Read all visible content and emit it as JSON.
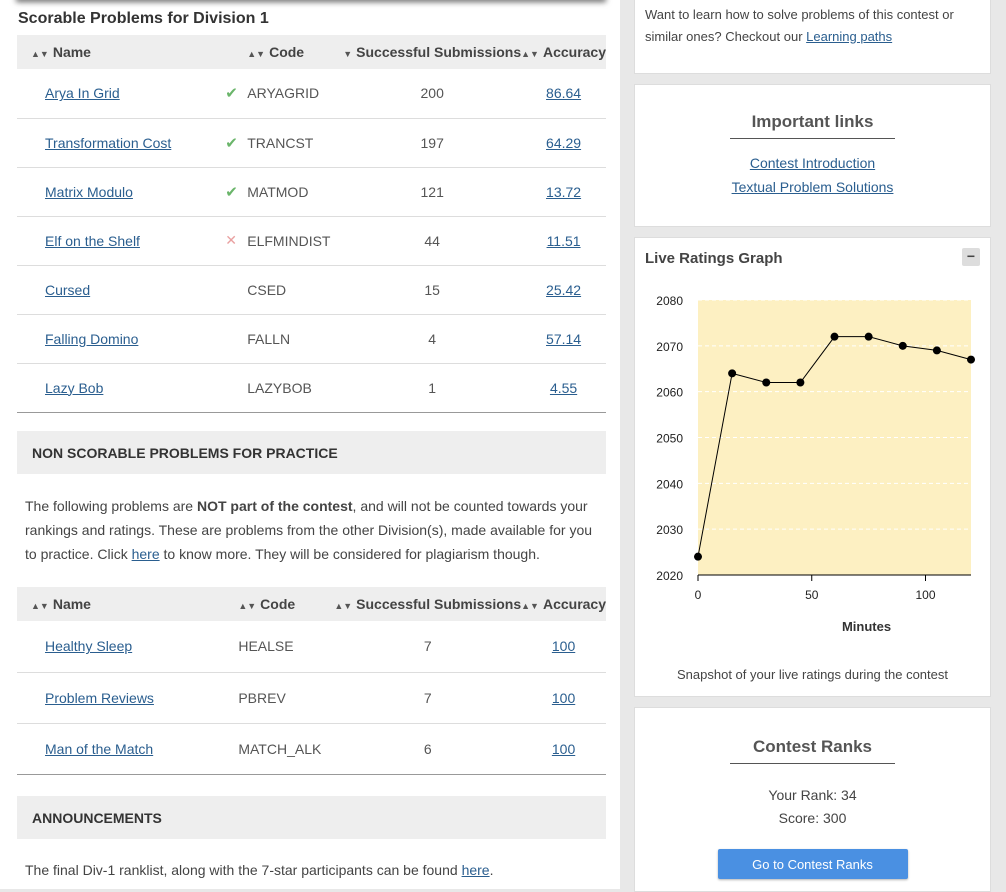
{
  "scorable": {
    "title": "Scorable Problems for Division 1",
    "headers": {
      "name": "Name",
      "code": "Code",
      "subs": "Successful Submissions",
      "acc": "Accuracy"
    },
    "rows": [
      {
        "name": "Arya In Grid",
        "status": "solved",
        "code": "ARYAGRID",
        "subs": "200",
        "acc": "86.64"
      },
      {
        "name": "Transformation Cost",
        "status": "solved",
        "code": "TRANCST",
        "subs": "197",
        "acc": "64.29"
      },
      {
        "name": "Matrix Modulo",
        "status": "solved",
        "code": "MATMOD",
        "subs": "121",
        "acc": "13.72"
      },
      {
        "name": "Elf on the Shelf",
        "status": "wrong",
        "code": "ELFMINDIST",
        "subs": "44",
        "acc": "11.51"
      },
      {
        "name": "Cursed",
        "status": "",
        "code": "CSED",
        "subs": "15",
        "acc": "25.42"
      },
      {
        "name": "Falling Domino",
        "status": "",
        "code": "FALLN",
        "subs": "4",
        "acc": "57.14"
      },
      {
        "name": "Lazy Bob",
        "status": "",
        "code": "LAZYBOB",
        "subs": "1",
        "acc": "4.55"
      }
    ]
  },
  "nonscorable": {
    "heading": "NON SCORABLE PROBLEMS FOR PRACTICE",
    "para_part1": "The following problems are ",
    "para_bold": "NOT part of the contest",
    "para_part2": ", and will not be counted towards your rankings and ratings. These are problems from the other Division(s), made available for you to practice. Click ",
    "para_link": "here",
    "para_part3": " to know more. They will be considered for plagiarism though.",
    "headers": {
      "name": "Name",
      "code": "Code",
      "subs": "Successful Submissions",
      "acc": "Accuracy"
    },
    "rows": [
      {
        "name": "Healthy Sleep",
        "code": "HEALSE",
        "subs": "7",
        "acc": "100"
      },
      {
        "name": "Problem Reviews",
        "code": "PBREV",
        "subs": "7",
        "acc": "100"
      },
      {
        "name": "Man of the Match",
        "code": "MATCH_ALK",
        "subs": "6",
        "acc": "100"
      }
    ]
  },
  "announcements": {
    "heading": "ANNOUNCEMENTS",
    "text_part1": "The final Div-1 ranklist, along with the 7-star participants can be found ",
    "link": "here",
    "text_part2": "."
  },
  "learn": {
    "text": "Want to learn how to solve problems of this contest or similar ones? Checkout our ",
    "link": "Learning paths"
  },
  "important_links": {
    "title": "Important links",
    "links": [
      "Contest Introduction",
      "Textual Problem Solutions"
    ]
  },
  "ratings_graph": {
    "title": "Live Ratings Graph",
    "collapse_label": "−",
    "caption": "Snapshot of your live ratings during the contest"
  },
  "chart_data": {
    "type": "line",
    "xlabel": "Minutes",
    "ylabel": "",
    "xlim": [
      0,
      120
    ],
    "ylim": [
      2020,
      2080
    ],
    "xticks": [
      0,
      50,
      100
    ],
    "yticks": [
      2020,
      2030,
      2040,
      2050,
      2060,
      2070,
      2080
    ],
    "x": [
      0,
      15,
      30,
      45,
      60,
      75,
      90,
      105,
      120
    ],
    "y": [
      2024,
      2064,
      2062,
      2062,
      2072,
      2072,
      2070,
      2069,
      2067
    ],
    "colors": {
      "plot_bg": "#fdf0c2",
      "line": "#000000"
    },
    "grid": true
  },
  "contest_ranks": {
    "title": "Contest Ranks",
    "rank_label": "Your Rank: 34",
    "score_label": "Score: 300",
    "button": "Go to Contest Ranks"
  }
}
